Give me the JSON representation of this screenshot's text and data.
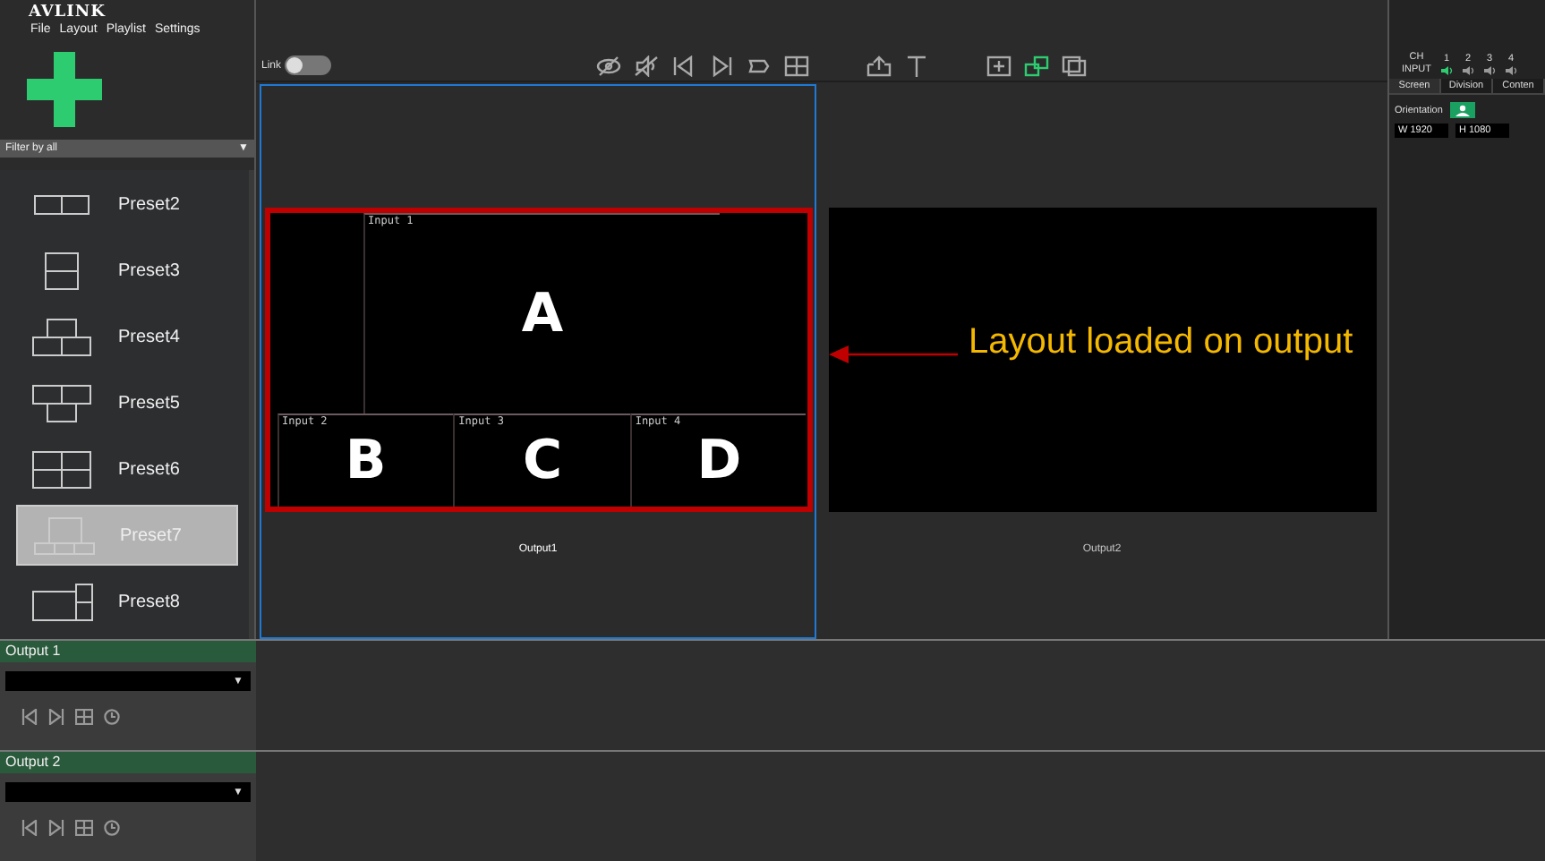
{
  "app": {
    "logo": "AVLINK"
  },
  "menu": [
    "File",
    "Layout",
    "Playlist",
    "Settings"
  ],
  "filter": {
    "value": "Filter by all",
    "caret": "▼"
  },
  "presets": [
    {
      "label": "Preset2",
      "selected": false
    },
    {
      "label": "Preset3",
      "selected": false
    },
    {
      "label": "Preset4",
      "selected": false
    },
    {
      "label": "Preset5",
      "selected": false
    },
    {
      "label": "Preset6",
      "selected": false
    },
    {
      "label": "Preset7",
      "selected": true
    },
    {
      "label": "Preset8",
      "selected": false
    }
  ],
  "toolbar": {
    "link_label": "Link",
    "link_on": false,
    "tools": [
      {
        "kind": "eye-off",
        "active": false
      },
      {
        "kind": "eye-off-2",
        "active": false
      },
      {
        "kind": "prev",
        "active": false
      },
      {
        "kind": "next",
        "active": false
      },
      {
        "kind": "bar",
        "active": false
      },
      {
        "kind": "grid",
        "active": false
      },
      {
        "kind": "export",
        "active": false
      },
      {
        "kind": "text",
        "active": false
      },
      {
        "kind": "frame",
        "active": false
      },
      {
        "kind": "cascade",
        "active": true
      },
      {
        "kind": "stack",
        "active": false
      }
    ]
  },
  "outputs": [
    {
      "label": "Output1",
      "selected": true,
      "windows": [
        {
          "label": "Input 1",
          "letter": "A"
        },
        {
          "label": "Input 2",
          "letter": "B"
        },
        {
          "label": "Input 3",
          "letter": "C"
        },
        {
          "label": "Input 4",
          "letter": "D"
        }
      ]
    },
    {
      "label": "Output2",
      "selected": false
    }
  ],
  "annotation": {
    "text": "Layout loaded on output"
  },
  "properties": {
    "ch_label": "CH",
    "input_label": "INPUT",
    "channels": [
      {
        "number": "1",
        "selected": true
      },
      {
        "number": "2",
        "selected": false
      },
      {
        "number": "3",
        "selected": false
      },
      {
        "number": "4",
        "selected": false
      }
    ],
    "tabs": [
      {
        "label": "Screen",
        "selected": true
      },
      {
        "label": "Division",
        "selected": false
      },
      {
        "label": "Conten",
        "selected": false
      }
    ],
    "orientation_label": "Orientation",
    "width": "W 1920",
    "height": "H 1080"
  },
  "output_panels": [
    {
      "title": "Output 1",
      "caret": "▼"
    },
    {
      "title": "Output 2",
      "caret": "▼"
    }
  ]
}
